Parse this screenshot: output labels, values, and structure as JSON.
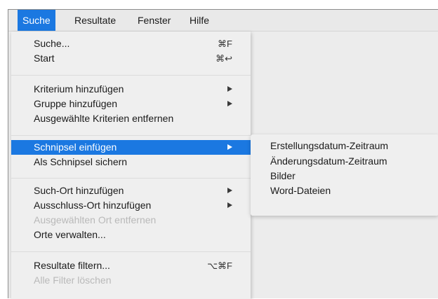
{
  "menubar": {
    "items": [
      {
        "label": "Suche",
        "active": true
      },
      {
        "label": "Resultate",
        "active": false
      },
      {
        "label": "Fenster",
        "active": false
      },
      {
        "label": "Hilfe",
        "active": false
      }
    ]
  },
  "suche_menu": {
    "items": [
      {
        "label": "Suche...",
        "shortcut": "⌘F"
      },
      {
        "label": "Start",
        "shortcut": "⌘↩"
      },
      {
        "label": "Kriterium hinzufügen",
        "submenu": true
      },
      {
        "label": "Gruppe hinzufügen",
        "submenu": true
      },
      {
        "label": "Ausgewählte Kriterien entfernen"
      },
      {
        "label": "Schnipsel einfügen",
        "submenu": true,
        "highlighted": true
      },
      {
        "label": "Als Schnipsel sichern"
      },
      {
        "label": "Such-Ort hinzufügen",
        "submenu": true
      },
      {
        "label": "Ausschluss-Ort hinzufügen",
        "submenu": true
      },
      {
        "label": "Ausgewählten Ort entfernen",
        "disabled": true
      },
      {
        "label": "Orte verwalten..."
      },
      {
        "label": "Resultate filtern...",
        "shortcut": "⌥⌘F"
      },
      {
        "label": "Alle Filter löschen",
        "disabled": true
      }
    ]
  },
  "schnipsel_submenu": {
    "items": [
      "Erstellungsdatum-Zeitraum",
      "Änderungsdatum-Zeitraum",
      "Bilder",
      "Word-Dateien"
    ]
  },
  "colors": {
    "highlight": "#1b78e1",
    "menu_bg": "#efefef",
    "disabled_text": "#b9b9b9"
  }
}
